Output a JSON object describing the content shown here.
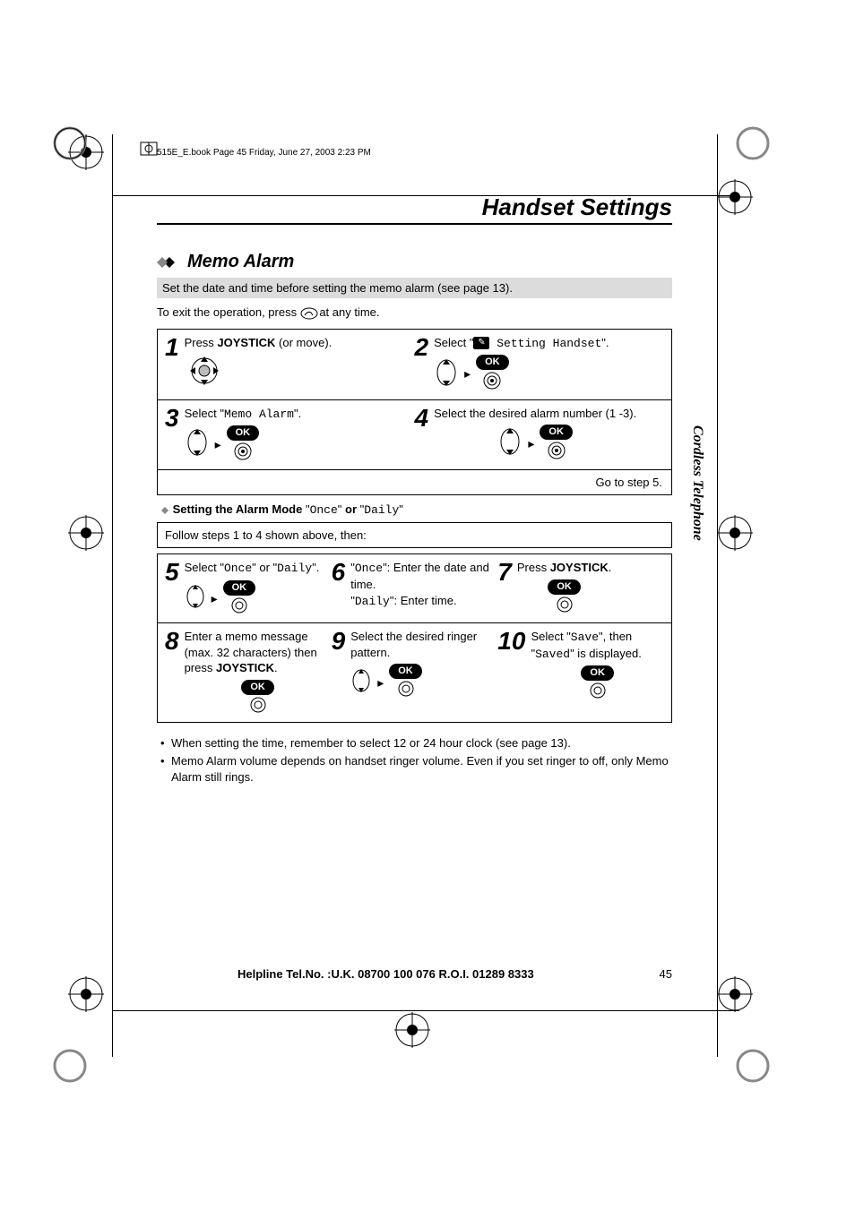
{
  "header_line": "515E_E.book  Page 45  Friday, June 27, 2003  2:23 PM",
  "page_title": "Handset Settings",
  "section": "Memo Alarm",
  "note": "Set the date and time before setting the memo alarm (see page 13).",
  "exit_pre": "To exit the operation, press ",
  "exit_post": " at any time.",
  "steps": {
    "s1_pre": "Press ",
    "s1_b": "JOYSTICK",
    "s1_post": " (or move).",
    "s2_pre": "Select \"",
    "s2_mono": "   Setting Handset",
    "s2_post": "\".",
    "s3_pre": "Select \"",
    "s3_mono": "Memo Alarm",
    "s3_post": "\".",
    "s4": "Select the desired alarm number (1 -3).",
    "go": "Go to step ",
    "go_b": "5",
    "go_dot": "."
  },
  "sub_heading_pre": "Setting the Alarm Mode ",
  "sub_heading_q1": "\"",
  "sub_heading_mono1": "Once",
  "sub_heading_q2": "\"",
  "sub_heading_or": " or ",
  "sub_heading_mono2": "Daily",
  "follow_pre": "Follow steps ",
  "follow_b1": "1",
  "follow_mid": " to ",
  "follow_b2": "4",
  "follow_post": " shown above, then:",
  "s5_pre": "Select \"",
  "s5_mono1": "Once",
  "s5_mid": "\" or \"",
  "s5_mono2": "Daily",
  "s5_post": "\".",
  "s6_l1_pre": "\"",
  "s6_l1_mono": "Once",
  "s6_l1_post": "\": Enter the date and time.",
  "s6_l2_pre": "\"",
  "s6_l2_mono": "Daily",
  "s6_l2_post": "\": Enter time.",
  "s7_pre": "Press ",
  "s7_b": "JOYSTICK",
  "s7_post": ".",
  "s8_l1": "Enter a memo message (max. 32 characters) then press ",
  "s8_b": "JOYSTICK",
  "s8_dot": ".",
  "s9": "Select the desired ringer pattern.",
  "s10_pre": "Select \"",
  "s10_mono1": "Save",
  "s10_mid": "\", then \"",
  "s10_mono2": "Saved",
  "s10_post": "\" is displayed.",
  "bullet1": "When setting the time, remember to select 12 or 24 hour clock (see page 13).",
  "bullet2": "Memo Alarm volume depends on handset ringer volume. Even if you set ringer to off, only Memo Alarm still rings.",
  "side_tab": "Cordless Telephone",
  "footer_b": "Helpline Tel.No. :U.K. 08700 100 076  R.O.I. 01289 8333",
  "page_num": "45",
  "ok_label": "OK"
}
